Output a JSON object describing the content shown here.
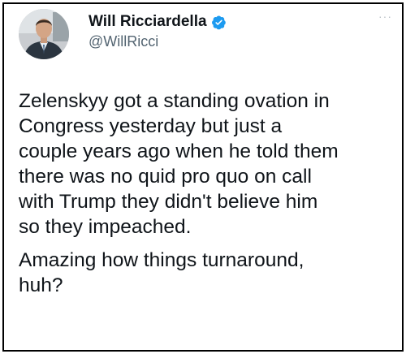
{
  "author": {
    "display_name": "Will Ricciardella",
    "handle": "@WillRicci",
    "verified": true,
    "avatar_icon": "user-avatar-photo"
  },
  "menu": {
    "more_icon": "more-options-icon",
    "more_glyph": "···"
  },
  "tweet": {
    "paragraphs": [
      "Zelenskyy got a standing ovation in\nCongress yesterday but just a\ncouple years ago when he told them\nthere was no quid pro quo on call\nwith Trump they didn't believe him\nso they impeached.",
      "Amazing how things turnaround,\nhuh?"
    ]
  },
  "colors": {
    "text": "#0f1419",
    "secondary_text": "#536471",
    "verified_badge": "#1d9bf0",
    "border": "#000000"
  }
}
